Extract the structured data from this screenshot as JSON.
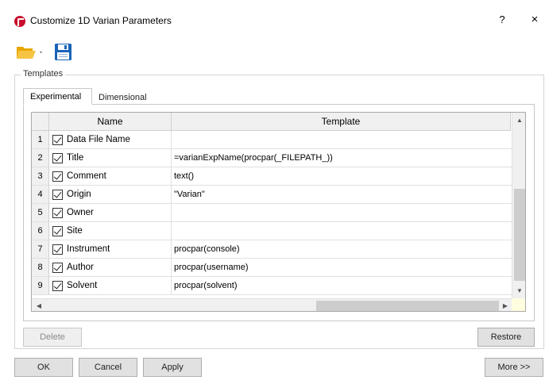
{
  "window": {
    "title": "Customize 1D Varian Parameters",
    "help_label": "?",
    "close_label": "×"
  },
  "toolbar": {
    "open_icon": "folder-open-icon",
    "save_icon": "floppy-save-icon"
  },
  "templates_group": {
    "label": "Templates"
  },
  "tabs": [
    {
      "label": "Experimental",
      "active": true
    },
    {
      "label": "Dimensional",
      "active": false
    }
  ],
  "table": {
    "columns": [
      "Name",
      "Template"
    ],
    "rows": [
      {
        "num": "1",
        "checked": true,
        "name": "Data File Name",
        "template": ""
      },
      {
        "num": "2",
        "checked": true,
        "name": "Title",
        "template": "=varianExpName(procpar(_FILEPATH_))"
      },
      {
        "num": "3",
        "checked": true,
        "name": "Comment",
        "template": "text()"
      },
      {
        "num": "4",
        "checked": true,
        "name": "Origin",
        "template": "\"Varian\""
      },
      {
        "num": "5",
        "checked": true,
        "name": "Owner",
        "template": ""
      },
      {
        "num": "6",
        "checked": true,
        "name": "Site",
        "template": ""
      },
      {
        "num": "7",
        "checked": true,
        "name": "Instrument",
        "template": "procpar(console)"
      },
      {
        "num": "8",
        "checked": true,
        "name": "Author",
        "template": "procpar(username)"
      },
      {
        "num": "9",
        "checked": true,
        "name": "Solvent",
        "template": "procpar(solvent)"
      }
    ]
  },
  "buttons": {
    "delete": "Delete",
    "restore": "Restore",
    "ok": "OK",
    "cancel": "Cancel",
    "apply": "Apply",
    "more": "More >>"
  },
  "colors": {
    "app_icon": "#c8102e",
    "folder": "#f0b400",
    "save": "#1565c0"
  }
}
